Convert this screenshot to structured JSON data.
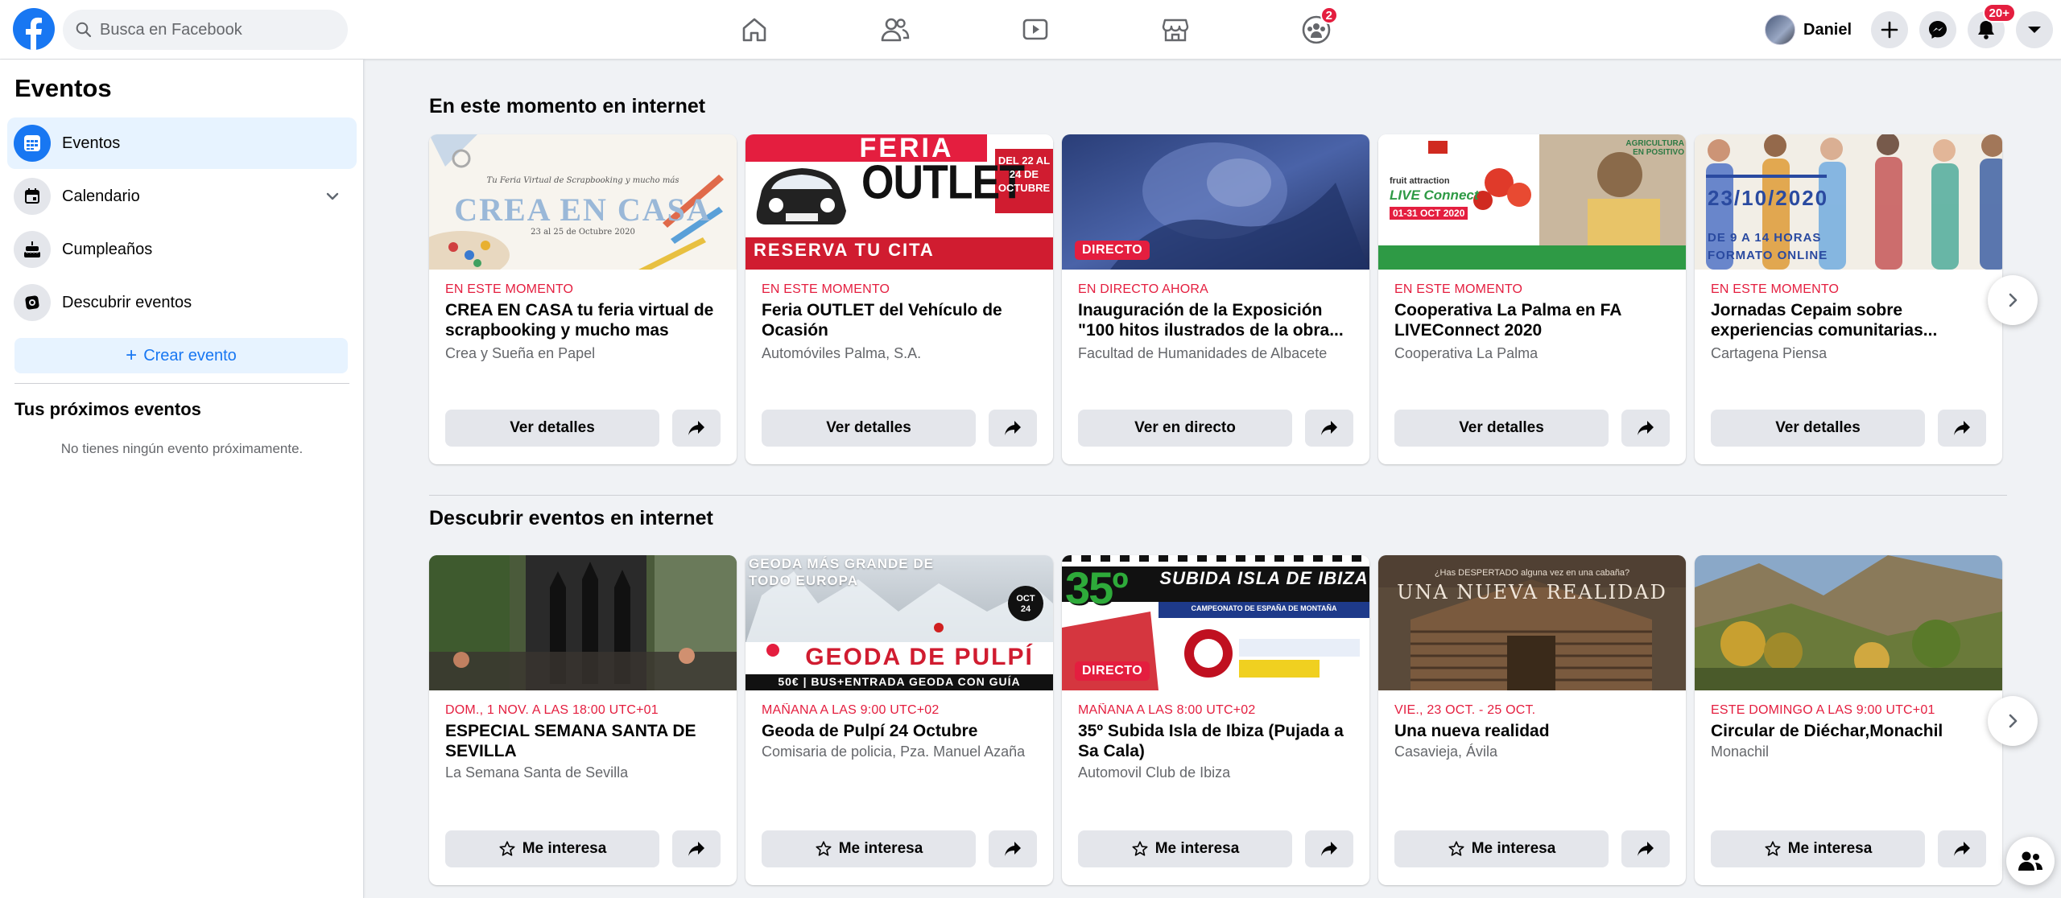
{
  "topbar": {
    "search_placeholder": "Busca en Facebook",
    "nav": [
      {
        "icon": "home-icon"
      },
      {
        "icon": "friends-icon"
      },
      {
        "icon": "watch-icon"
      },
      {
        "icon": "marketplace-icon"
      },
      {
        "icon": "groups-icon",
        "badge": "2"
      }
    ],
    "profile_name": "Daniel",
    "notifications_badge": "20+"
  },
  "sidebar": {
    "title": "Eventos",
    "items": [
      {
        "label": "Eventos",
        "icon": "events-grid-icon"
      },
      {
        "label": "Calendario",
        "icon": "calendar-icon"
      },
      {
        "label": "Cumpleaños",
        "icon": "birthday-cake-icon"
      },
      {
        "label": "Descubrir eventos",
        "icon": "discover-icon"
      }
    ],
    "create_label": "Crear evento",
    "upcoming_title": "Tus próximos eventos",
    "upcoming_empty": "No tienes ningún evento próximamente."
  },
  "sections": [
    {
      "title": "En este momento en internet",
      "cards": [
        {
          "date": "EN ESTE MOMENTO",
          "title": "CREA EN CASA tu feria virtual de scrapbooking y mucho mas",
          "subtitle": "Crea y Sueña en Papel",
          "button": "Ver detalles",
          "live": "",
          "image_text": "CREA EN CASA",
          "image_caption": "Tu Feria Virtual de Scrapbooking y mucho más",
          "image_dates": "23 al 25 de Octubre 2020"
        },
        {
          "date": "EN ESTE MOMENTO",
          "title": "Feria OUTLET del Vehículo de Ocasión",
          "subtitle": "Automóviles Palma, S.A.",
          "button": "Ver detalles",
          "live": "",
          "image_text": "OUTLET",
          "image_top": "FERIA",
          "image_bottom": "RESERVA TU CITA",
          "image_side": "DEL 22 AL 24 DE OCTUBRE"
        },
        {
          "date": "EN DIRECTO AHORA",
          "title": "Inauguración de la Exposición \"100 hitos ilustrados de la obra...",
          "subtitle": "Facultad de Humanidades de Albacete",
          "button": "Ver en directo",
          "live": "DIRECTO"
        },
        {
          "date": "EN ESTE MOMENTO",
          "title": "Cooperativa La Palma en FA LIVEConnect 2020",
          "subtitle": "Cooperativa La Palma",
          "button": "Ver detalles",
          "live": "",
          "image_text": "LIVE Connect",
          "image_dates": "01-31 OCT 2020",
          "image_side": "AGRICULTURA EN POSITIVO"
        },
        {
          "date": "EN ESTE MOMENTO",
          "title": "Jornadas Cepaim sobre experiencias comunitarias...",
          "subtitle": "Cartagena Piensa",
          "button": "Ver detalles",
          "live": "",
          "image_text": "23/10/2020",
          "image_caption": "DE 9 A 14 HORAS",
          "image_dates": "FORMATO ONLINE"
        }
      ]
    },
    {
      "title": "Descubrir eventos en internet",
      "cards": [
        {
          "date": "DOM., 1 NOV. A LAS 18:00 UTC+01",
          "title": "ESPECIAL SEMANA SANTA DE SEVILLA",
          "subtitle": "La Semana Santa de Sevilla",
          "button": "Me interesa",
          "live": ""
        },
        {
          "date": "MAÑANA A LAS 9:00 UTC+02",
          "title": "Geoda de Pulpí 24 Octubre",
          "subtitle": "Comisaria de policia, Pza. Manuel Azaña",
          "button": "Me interesa",
          "live": "",
          "image_text": "GEODA DE PULPÍ",
          "image_caption": "GEODA MÁS GRANDE DE TODO EUROPA",
          "image_dates": "50€ | BUS+ENTRADA GEODA CON GUÍA",
          "image_side": "OCT 24"
        },
        {
          "date": "MAÑANA A LAS 8:00 UTC+02",
          "title": "35º Subida Isla de Ibiza (Pujada a Sa Cala)",
          "subtitle": "Automovil Club de Ibiza",
          "button": "Me interesa",
          "live": "DIRECTO",
          "image_text": "SUBIDA ISLA DE IBIZA",
          "image_top": "35º",
          "image_caption": "CAMPEONATO DE ESPAÑA DE MONTAÑA"
        },
        {
          "date": "VIE., 23 OCT. - 25 OCT.",
          "title": "Una nueva realidad",
          "subtitle": "Casavieja, Ávila",
          "button": "Me interesa",
          "live": "",
          "image_text": "UNA NUEVA REALIDAD",
          "image_caption": "¿Has DESPERTADO alguna vez en una cabaña?"
        },
        {
          "date": "ESTE DOMINGO A LAS 9:00 UTC+01",
          "title": "Circular de Diéchar,Monachil",
          "subtitle": "Monachil",
          "button": "Me interesa",
          "live": ""
        }
      ]
    }
  ]
}
